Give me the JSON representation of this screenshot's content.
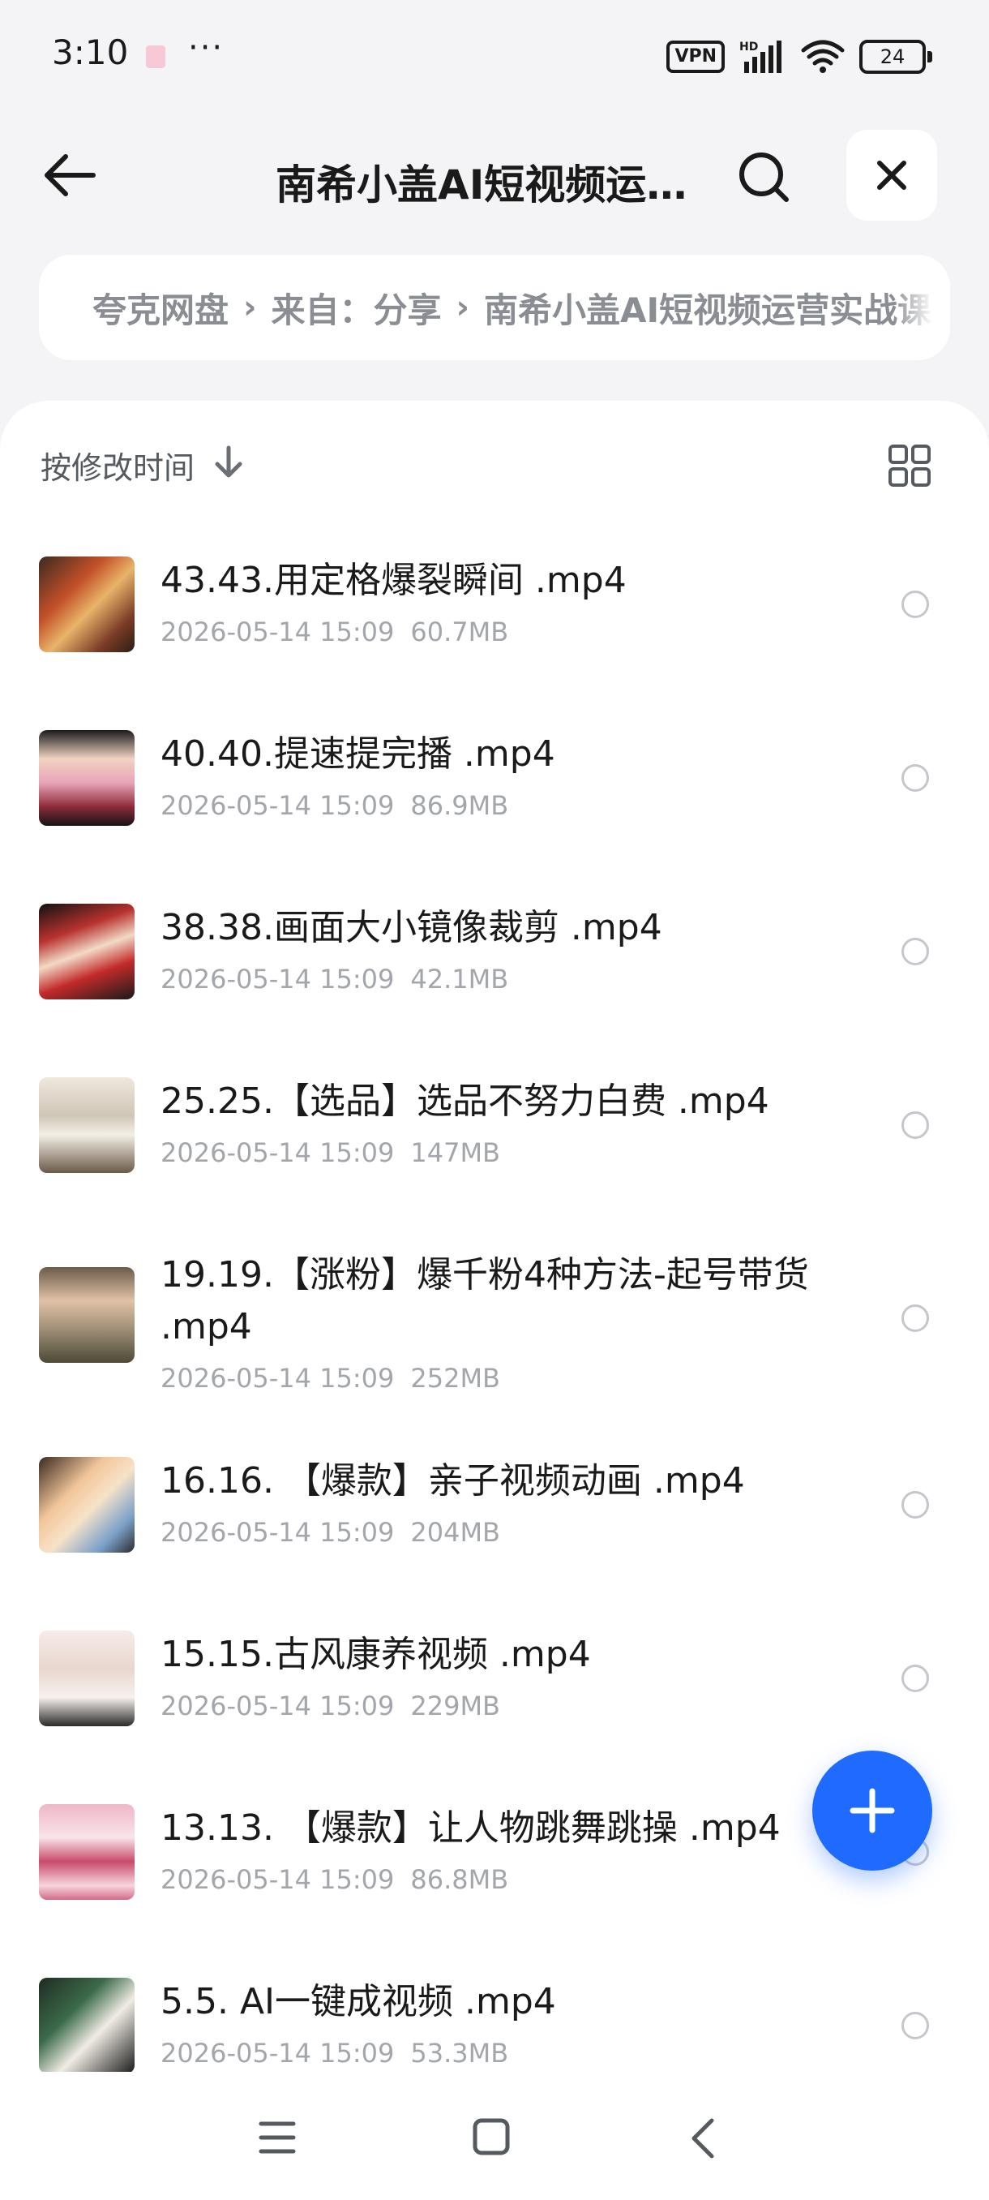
{
  "status_bar": {
    "time": "3:10",
    "dots": "···",
    "vpn": "VPN",
    "battery": "24",
    "icons": [
      "app-notification-icon",
      "hd-signal-icon",
      "wifi-icon",
      "battery-icon"
    ]
  },
  "header": {
    "title": "南希小盖AI短视频运营实战课",
    "icons": [
      "back-arrow-icon",
      "search-icon",
      "close-icon"
    ]
  },
  "breadcrumb": {
    "items": [
      "夸克网盘",
      "来自：分享",
      "南希小盖AI短视频运营实战课"
    ],
    "separator": "›"
  },
  "sort": {
    "label": "按修改时间",
    "icons": [
      "sort-descending-icon",
      "grid-view-icon"
    ]
  },
  "files": [
    {
      "name": "43.43.用定格爆裂瞬间 .mp4",
      "date": "2026-05-14 15:09",
      "size": "60.7MB"
    },
    {
      "name": "40.40.提速提完播 .mp4",
      "date": "2026-05-14 15:09",
      "size": "86.9MB"
    },
    {
      "name": "38.38.画面大小镜像裁剪 .mp4",
      "date": "2026-05-14 15:09",
      "size": "42.1MB"
    },
    {
      "name": "25.25.【选品】选品不努力白费 .mp4",
      "date": "2026-05-14 15:09",
      "size": "147MB"
    },
    {
      "name": "19.19.【涨粉】爆千粉4种方法-起号带货 .mp4",
      "date": "2026-05-14 15:09",
      "size": "252MB"
    },
    {
      "name": "16.16. 【爆款】亲子视频动画 .mp4",
      "date": "2026-05-14 15:09",
      "size": "204MB"
    },
    {
      "name": "15.15.古风康养视频 .mp4",
      "date": "2026-05-14 15:09",
      "size": "229MB"
    },
    {
      "name": "13.13. 【爆款】让人物跳舞跳操 .mp4",
      "date": "2026-05-14 15:09",
      "size": "86.8MB"
    },
    {
      "name": "5.5. AI一键成视频 .mp4",
      "date": "2026-05-14 15:09",
      "size": "53.3MB"
    }
  ],
  "fab": {
    "icon": "plus-icon"
  },
  "nav": {
    "icons": [
      "menu-icon",
      "home-square-icon",
      "back-chevron-icon"
    ]
  },
  "colors": {
    "accent": "#1f6bff",
    "background": "#f4f4f6",
    "meta_text": "#a3a6ab",
    "breadcrumb_text": "#8a8d93"
  }
}
